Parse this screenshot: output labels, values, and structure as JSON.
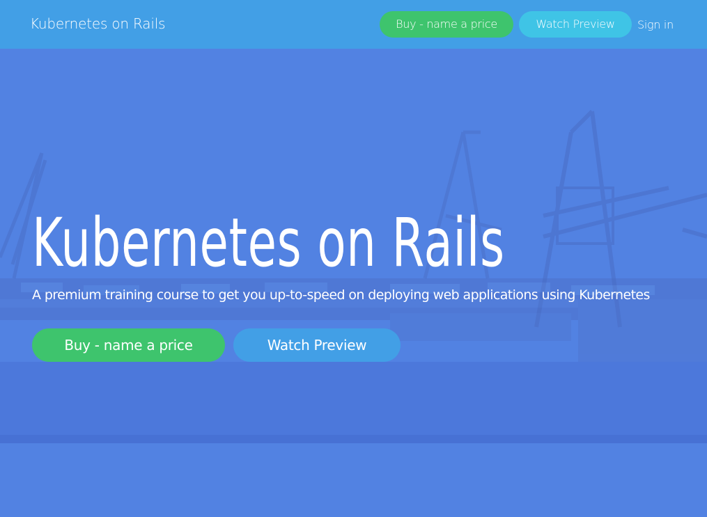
{
  "navbar": {
    "brand": "Kubernetes on Rails",
    "buy_label": "Buy - name a price",
    "watch_label": "Watch Preview",
    "signin_label": "Sign in"
  },
  "hero": {
    "title": "Kubernetes on Rails",
    "subtitle": "A premium training course to get you up-to-speed on deploying web applications using Kubernetes",
    "buy_label": "Buy - name a price",
    "watch_label": "Watch Preview"
  },
  "colors": {
    "navbar_bg": "#429fe6",
    "hero_overlay": "#4f7fe0",
    "buy_green": "#3ec46d",
    "watch_cyan": "#3fc4e6",
    "watch_blue": "#429fe6",
    "text": "#ffffff"
  }
}
